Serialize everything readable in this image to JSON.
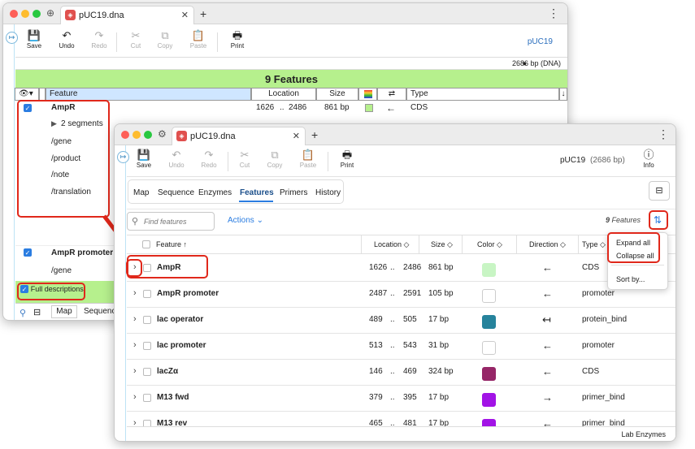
{
  "back": {
    "tab_title": "pUC19.dna",
    "toolbar": {
      "save": "Save",
      "undo": "Undo",
      "redo": "Redo",
      "cut": "Cut",
      "copy": "Copy",
      "paste": "Paste",
      "print": "Print"
    },
    "seq_name": "pUC19",
    "seq_info": "2686 bp  (DNA)",
    "features_title": "9 Features",
    "columns": {
      "feature": "Feature",
      "location": "Location",
      "size": "Size",
      "type": "Type"
    },
    "ampr": {
      "name": "AmpR",
      "start": "1626",
      "sep": "..",
      "end": "2486",
      "size": "861 bp",
      "type": "CDS"
    },
    "segments": "2 segments",
    "qualifiers": [
      "/gene",
      "/product",
      "/note",
      "/translation"
    ],
    "promoter": {
      "name": "AmpR promoter",
      "qualifier": "/gene"
    },
    "full_desc": "Full descriptions",
    "bottom_tabs": [
      "Map",
      "Sequence"
    ]
  },
  "front": {
    "tab_title": "pUC19.dna",
    "toolbar": {
      "save": "Save",
      "undo": "Undo",
      "redo": "Redo",
      "cut": "Cut",
      "copy": "Copy",
      "paste": "Paste",
      "print": "Print",
      "info": "Info"
    },
    "seq_name": "pUC19",
    "seq_size": "(2686 bp)",
    "view_tabs": [
      "Map",
      "Sequence",
      "Enzymes",
      "Features",
      "Primers",
      "History"
    ],
    "active_tab": "Features",
    "search": {
      "placeholder": "Find features"
    },
    "actions": "Actions",
    "count": "9",
    "count_label": "Features",
    "headers": {
      "feature": "Feature",
      "location": "Location",
      "size": "Size",
      "color": "Color",
      "direction": "Direction",
      "type": "Type"
    },
    "rows": [
      {
        "name": "AmpR",
        "start": "1626",
        "end": "2486",
        "size": "861 bp",
        "color": "#c8f5c4",
        "dir": "←",
        "type": "CDS"
      },
      {
        "name": "AmpR promoter",
        "start": "2487",
        "end": "2591",
        "size": "105 bp",
        "color": "#ffffff",
        "dir": "←",
        "type": "promoter"
      },
      {
        "name": "lac operator",
        "start": "489",
        "end": "505",
        "size": "17 bp",
        "color": "#26839c",
        "dir": "↤",
        "type": "protein_bind"
      },
      {
        "name": "lac promoter",
        "start": "513",
        "end": "543",
        "size": "31 bp",
        "color": "#ffffff",
        "dir": "←",
        "type": "promoter"
      },
      {
        "name": "lacZα",
        "start": "146",
        "end": "469",
        "size": "324 bp",
        "color": "#962667",
        "dir": "←",
        "type": "CDS"
      },
      {
        "name": "M13 fwd",
        "start": "379",
        "end": "395",
        "size": "17 bp",
        "color": "#a213e6",
        "dir": "→",
        "type": "primer_bind"
      },
      {
        "name": "M13 rev",
        "start": "465",
        "end": "481",
        "size": "17 bp",
        "color": "#a213e6",
        "dir": "←",
        "type": "primer_bind"
      }
    ],
    "menu": {
      "expand": "Expand all",
      "collapse": "Collapse all",
      "sort": "Sort by..."
    },
    "footer": "Lab Enzymes"
  }
}
